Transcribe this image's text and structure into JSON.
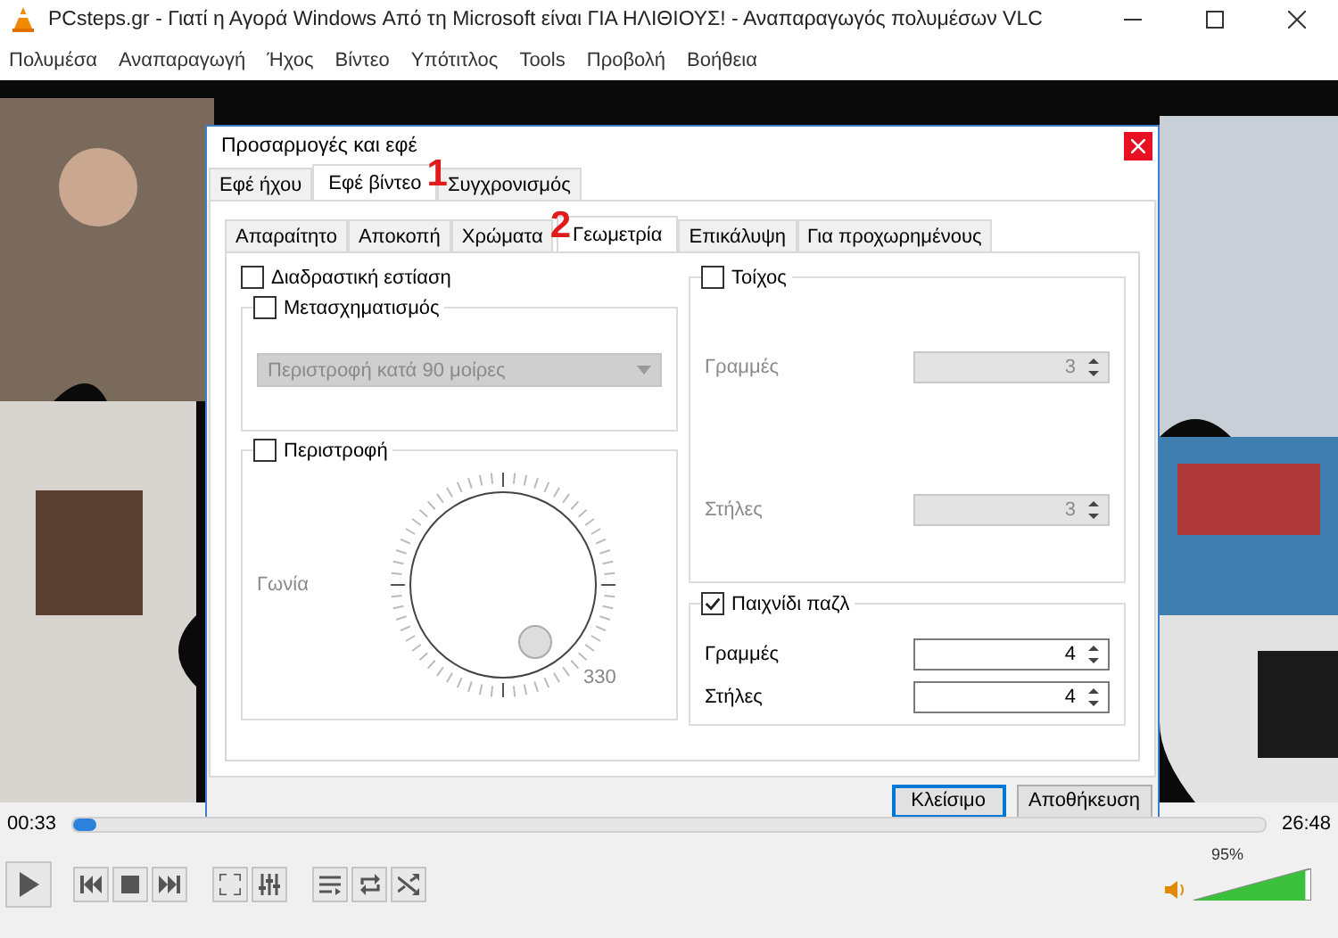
{
  "window": {
    "title": "PCsteps.gr - Γιατί η Αγορά Windows Από τη Microsoft είναι ΓΙΑ ΗΛΙΘΙΟΥΣ! - Αναπαραγωγός πολυμέσων VLC"
  },
  "menu": [
    "Πολυμέσα",
    "Αναπαραγωγή",
    "Ήχος",
    "Βίντεο",
    "Υπότιτλος",
    "Tools",
    "Προβολή",
    "Βοήθεια"
  ],
  "dialog": {
    "title": "Προσαρμογές και εφέ",
    "tabs": [
      {
        "label": "Εφέ ήχου",
        "selected": false
      },
      {
        "label": "Εφέ βίντεο",
        "selected": true
      },
      {
        "label": "Συγχρονισμός",
        "selected": false
      }
    ],
    "subtabs": [
      {
        "label": "Απαραίτητο",
        "selected": false
      },
      {
        "label": "Αποκοπή",
        "selected": false
      },
      {
        "label": "Χρώματα",
        "selected": false
      },
      {
        "label": "Γεωμετρία",
        "selected": true
      },
      {
        "label": "Επικάλυψη",
        "selected": false
      },
      {
        "label": "Για προχωρημένους",
        "selected": false
      }
    ],
    "annotations": [
      "1",
      "2"
    ],
    "interactive_zoom": {
      "label": "Διαδραστική εστίαση",
      "checked": false
    },
    "transform": {
      "label": "Μετασχηματισμός",
      "checked": false,
      "dropdown": "Περιστροφή κατά 90 μοίρες"
    },
    "rotate": {
      "label": "Περιστροφή",
      "checked": false,
      "angle_label": "Γωνία",
      "dial_label": "330"
    },
    "wall": {
      "label": "Τοίχος",
      "checked": false,
      "rows_label": "Γραμμές",
      "rows": "3",
      "cols_label": "Στήλες",
      "cols": "3"
    },
    "puzzle": {
      "label": "Παιχνίδι παζλ",
      "checked": true,
      "rows_label": "Γραμμές",
      "rows": "4",
      "cols_label": "Στήλες",
      "cols": "4"
    },
    "buttons": [
      {
        "label": "Κλείσιμο",
        "default": true
      },
      {
        "label": "Αποθήκευση",
        "default": false
      }
    ]
  },
  "player": {
    "elapsed": "00:33",
    "total": "26:48",
    "progress": {
      "level": 0.02
    },
    "volume": {
      "level": 0.95,
      "reading": "95%"
    }
  }
}
